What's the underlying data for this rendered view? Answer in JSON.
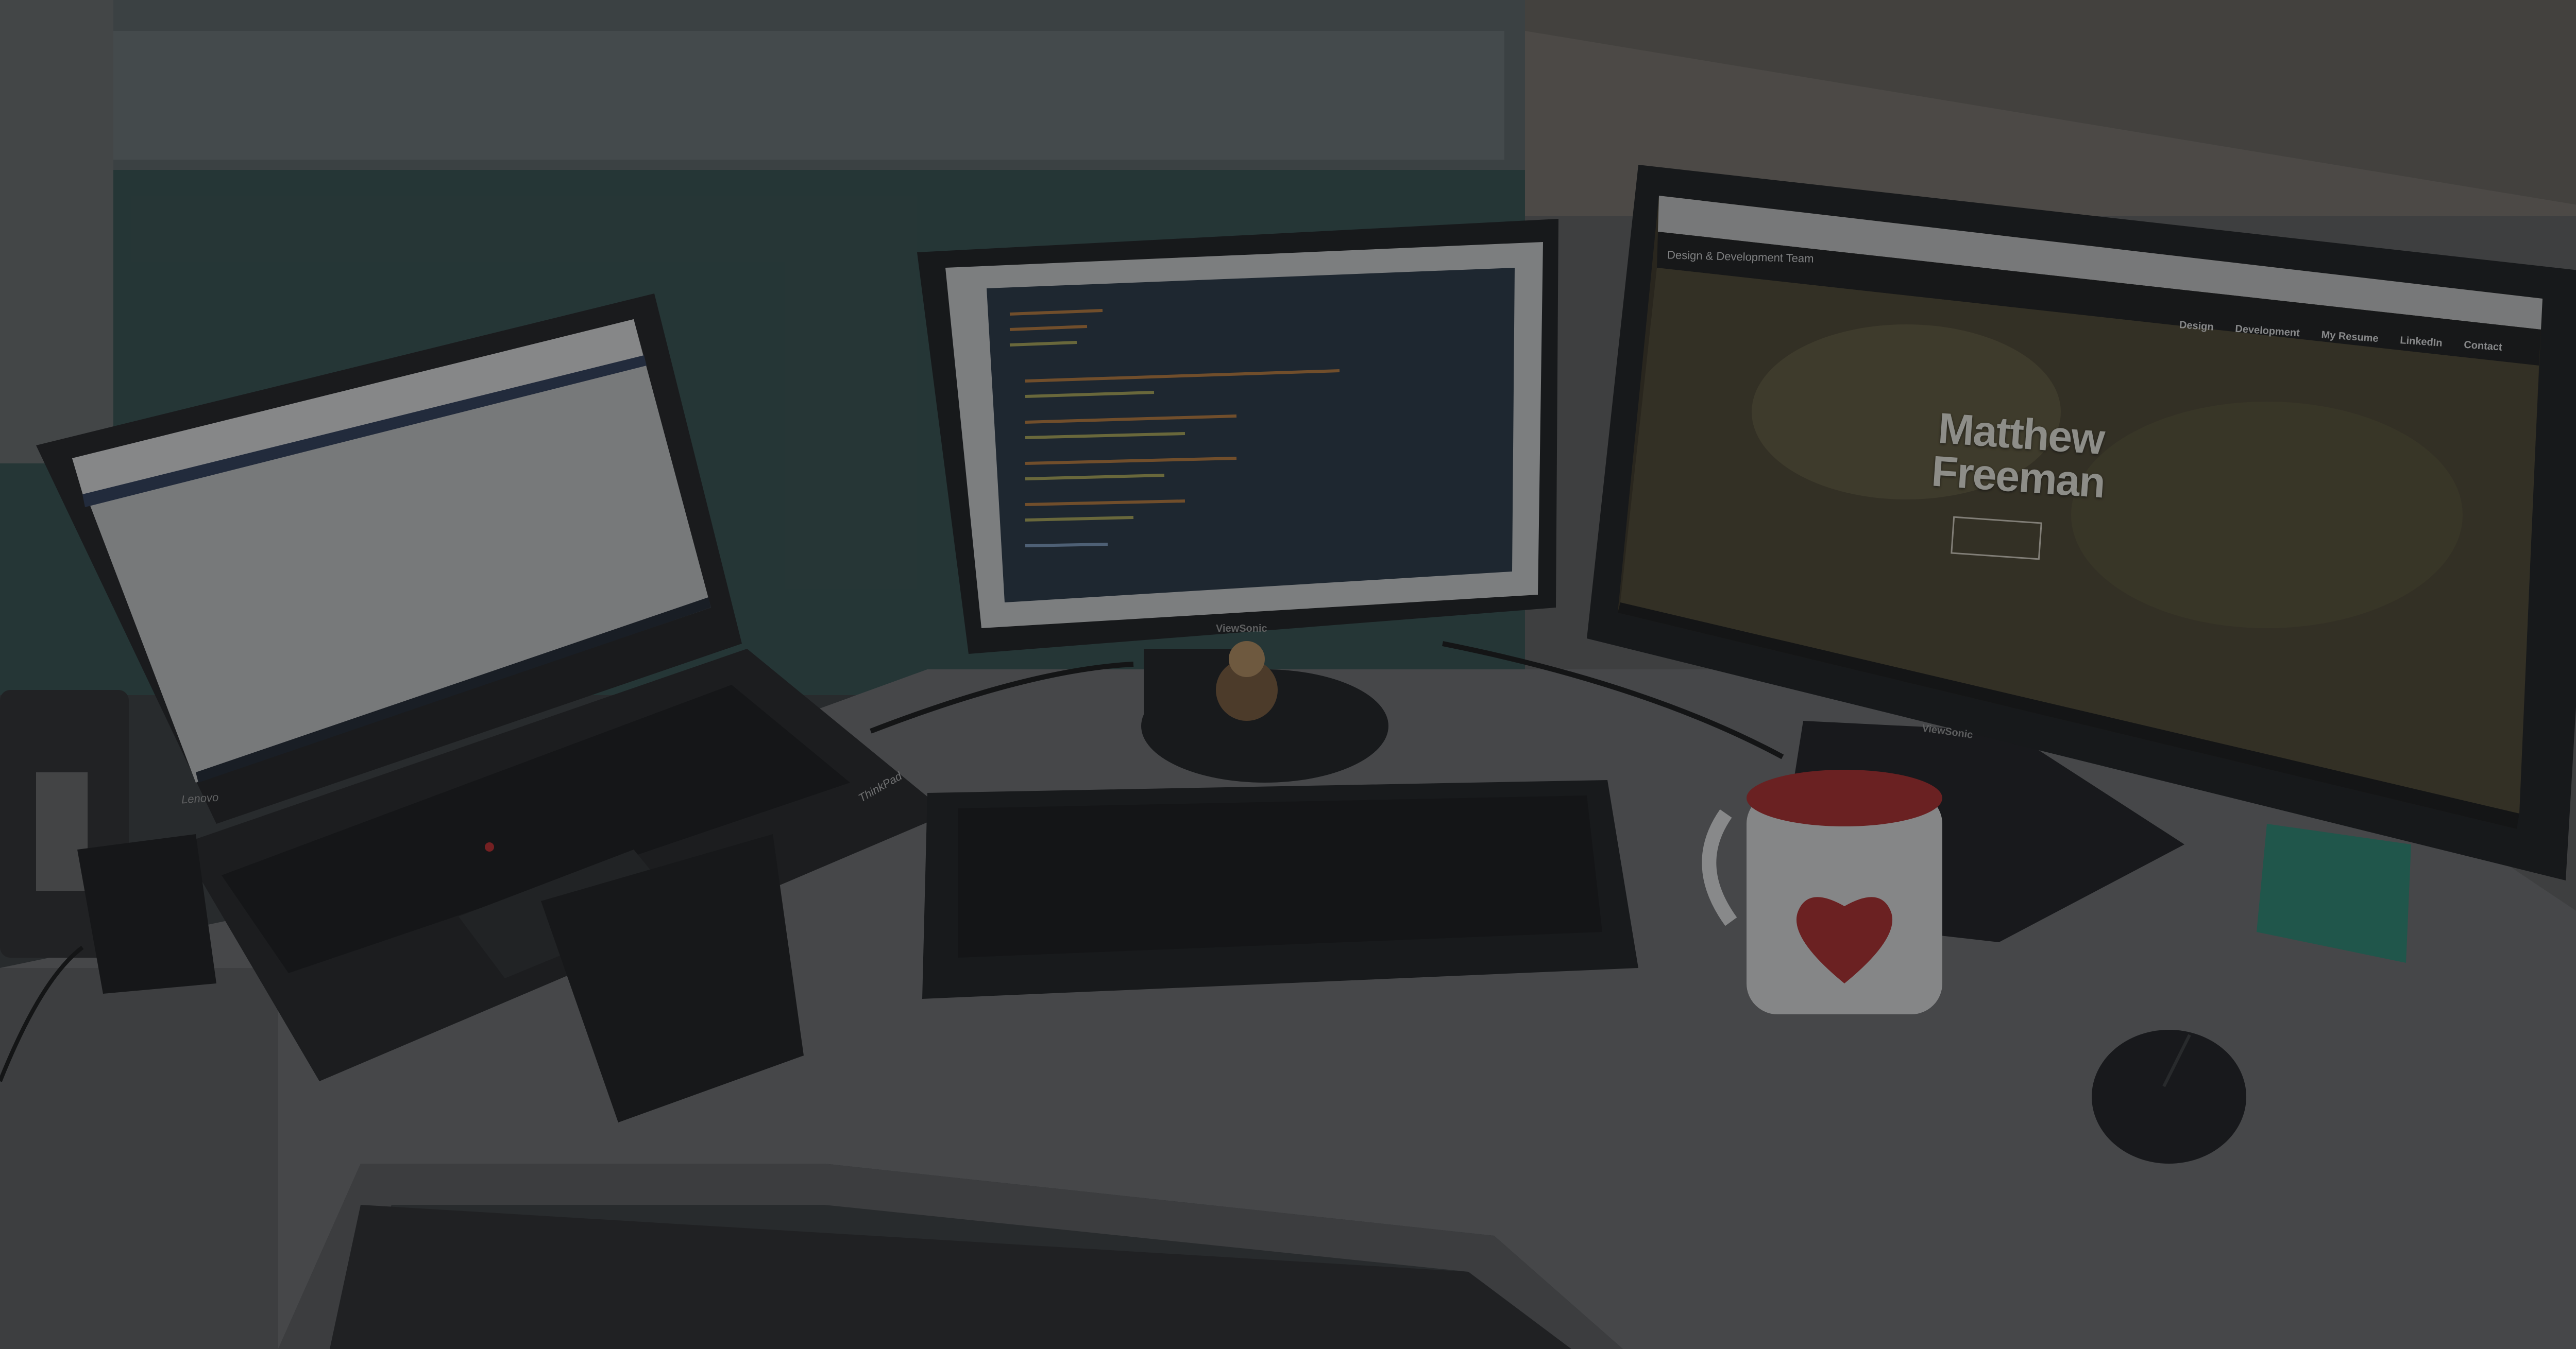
{
  "scene": {
    "description_colors": {
      "wall_teal": "#3d5a5a",
      "desk": "#6d6e70",
      "mug_red": "#c0282a",
      "sticky_note": "#2f9b85"
    }
  },
  "right_monitor": {
    "site_name": "Design & Development Team",
    "hero_title": "Matthew Freeman",
    "nav": [
      "Design",
      "Development",
      "My Resume",
      "LinkedIn",
      "Contact"
    ],
    "brand": "ViewSonic"
  },
  "center_monitor": {
    "brand": "ViewSonic"
  },
  "laptop": {
    "brand": "Lenovo",
    "logo": "ThinkPad"
  }
}
